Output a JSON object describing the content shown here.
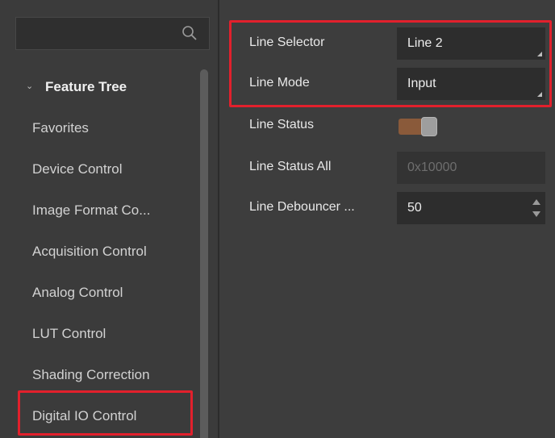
{
  "search": {
    "placeholder": "",
    "icon": "search-icon"
  },
  "tree": {
    "header": "Feature Tree",
    "items": [
      {
        "label": "Favorites"
      },
      {
        "label": "Device Control"
      },
      {
        "label": "Image Format Co..."
      },
      {
        "label": "Acquisition Control"
      },
      {
        "label": "Analog Control"
      },
      {
        "label": "LUT Control"
      },
      {
        "label": "Shading Correction"
      },
      {
        "label": "Digital IO Control"
      }
    ]
  },
  "properties": [
    {
      "label": "Line Selector",
      "value": "Line 2",
      "type": "combo"
    },
    {
      "label": "Line Mode",
      "value": "Input",
      "type": "combo"
    },
    {
      "label": "Line Status",
      "value": "",
      "type": "toggle"
    },
    {
      "label": "Line Status All",
      "value": "0x10000",
      "type": "readonly"
    },
    {
      "label": "Line Debouncer ...",
      "value": "50",
      "type": "spin"
    }
  ],
  "colors": {
    "highlight": "#e2202c",
    "toggle_on": "#8a5a3a"
  }
}
